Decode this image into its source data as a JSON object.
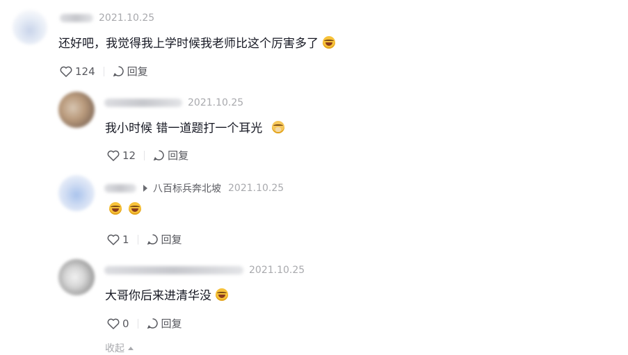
{
  "comments": [
    {
      "date": "2021.10.25",
      "text": "还好吧，我觉得我上学时候我老师比这个厉害多了",
      "emoji": "rofl-emoji",
      "likes": "124",
      "reply_label": "回复"
    }
  ],
  "replies": [
    {
      "date": "2021.10.25",
      "text": "我小时候 错一道题打一个耳光",
      "emoji": "pray-emoji",
      "likes": "12",
      "reply_label": "回复"
    },
    {
      "reply_to": "八百标兵奔北坡",
      "date": "2021.10.25",
      "text": "",
      "emoji": "rofl-emoji",
      "likes": "1",
      "reply_label": "回复"
    },
    {
      "date": "2021.10.25",
      "text": "大哥你后来进清华没",
      "emoji": "rofl-emoji",
      "likes": "0",
      "reply_label": "回复"
    }
  ],
  "collapse_label": "收起",
  "colors": {
    "text": "#161823",
    "meta": "#a8a9ad",
    "action": "#57585e"
  }
}
